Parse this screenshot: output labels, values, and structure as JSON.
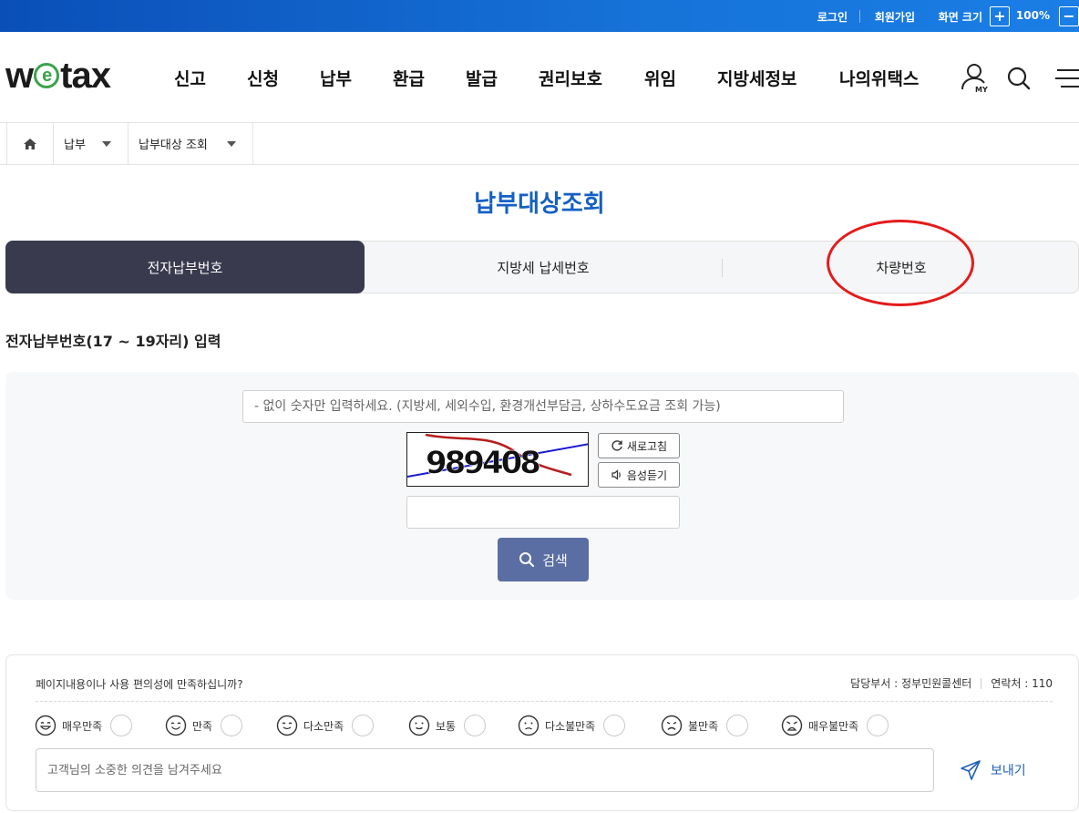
{
  "topbar": {
    "login": "로그인",
    "join": "회원가입",
    "zoom_label": "화면 크기",
    "zoom_in": "+",
    "zoom_value": "100%",
    "zoom_out": "−"
  },
  "header": {
    "logo_left": "w",
    "logo_e": "e",
    "logo_right": "tax",
    "nav": [
      "신고",
      "신청",
      "납부",
      "환급",
      "발급",
      "권리보호",
      "위임",
      "지방세정보",
      "나의위택스"
    ],
    "my_label": "MY"
  },
  "breadcrumb": {
    "level1": "납부",
    "level2": "납부대상 조회"
  },
  "page": {
    "title": "납부대상조회"
  },
  "tabs": [
    {
      "label": "전자납부번호",
      "active": true
    },
    {
      "label": "지방세 납세번호",
      "active": false
    },
    {
      "label": "차량번호",
      "active": false
    }
  ],
  "form": {
    "section_label": "전자납부번호(17 ~ 19자리) 입력",
    "main_placeholder": "- 없이 숫자만 입력하세요. (지방세, 세외수입, 환경개선부담금, 상하수도요금 조회 가능)",
    "captcha_text": "989408",
    "refresh_label": "새로고침",
    "audio_label": "음성듣기",
    "search_label": "검색"
  },
  "survey": {
    "question": "페이지내용이나 사용 편의성에 만족하십니까?",
    "dept": "담당부서 : 정부민원콜센터",
    "contact": "연락처 : 110",
    "options": [
      "매우만족",
      "만족",
      "다소만족",
      "보통",
      "다소불만족",
      "불만족",
      "매우불만족"
    ],
    "opinion_placeholder": "고객님의 소중한 의견을 남겨주세요",
    "send_label": "보내기"
  },
  "colors": {
    "brand_blue": "#1560c4",
    "tab_active": "#3a3a4e",
    "search_button": "#5a6ea3",
    "logo_green": "#3aa34a",
    "annotation_red": "#e41b1b"
  }
}
